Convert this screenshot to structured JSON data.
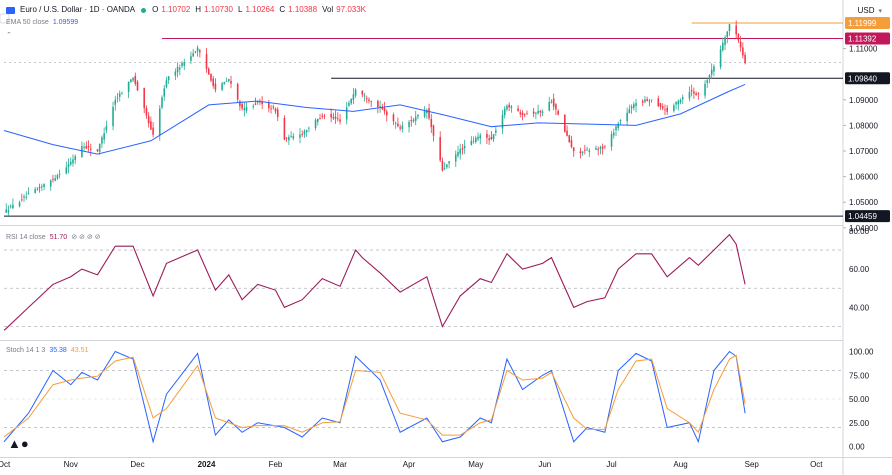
{
  "symbol": {
    "title": "Euro / U.S. Dollar · 1D · OANDA",
    "o_label": "O",
    "o": "1.10702",
    "h_label": "H",
    "h": "1.10730",
    "l_label": "L",
    "l": "1.10264",
    "c_label": "C",
    "c": "1.10388",
    "vol_label": "Vol",
    "vol": "97.033K",
    "currency": "USD"
  },
  "ema_legend": {
    "label": "EMA 50 close",
    "value": "1.09599"
  },
  "rsi_legend": {
    "label": "RSI 14 close",
    "value": "51.70"
  },
  "stoch_legend": {
    "label": "Stoch 14 1 3",
    "k": "35.38",
    "d": "43.51"
  },
  "colors": {
    "up": "#22ab94",
    "down": "#f23645",
    "ema": "#2962ff",
    "rsi": "#9c1b5b",
    "stoch_k": "#2962ff",
    "stoch_d": "#f59d3a",
    "high_line": "#f59d3a",
    "mid_line": "#c2185b",
    "support": "#131722"
  },
  "chart_data": [
    {
      "type": "candlestick",
      "price_labels": [
        {
          "value": 1.11999,
          "text": "1.11999",
          "color": "#f59d3a"
        },
        {
          "value": 1.11392,
          "text": "1.11392",
          "color": "#c2185b"
        },
        {
          "value": 1.0984,
          "text": "1.09840",
          "color": "#131722"
        },
        {
          "value": 1.04459,
          "text": "1.04459",
          "color": "#131722"
        }
      ],
      "horizontal_lines": [
        {
          "value": 1.11999,
          "from": "2024-08-06",
          "color": "#f59d3a"
        },
        {
          "value": 1.11392,
          "from": "2023-12-12",
          "color": "#c2185b"
        },
        {
          "value": 1.0984,
          "from": "2024-02-26",
          "color": "#131722"
        },
        {
          "value": 1.04459,
          "from": "2023-10-02",
          "color": "#131722"
        }
      ],
      "y_ticks": [
        1.11,
        1.09,
        1.08,
        1.07,
        1.06,
        1.05,
        1.04
      ],
      "y_tick_labels": [
        "1.11000",
        "1.09000",
        "1.08000",
        "1.07000",
        "1.06000",
        "1.05000",
        "1.04000"
      ],
      "ylim": [
        1.0415,
        1.1235
      ],
      "x_tick_labels": [
        "Oct",
        "Nov",
        "Dec",
        "2024",
        "Feb",
        "Mar",
        "Apr",
        "May",
        "Jun",
        "Jul",
        "Aug",
        "Sep",
        "Oct"
      ],
      "x_tick_dates": [
        "2023-10-02",
        "2023-11-01",
        "2023-12-01",
        "2024-01-01",
        "2024-02-01",
        "2024-03-01",
        "2024-04-01",
        "2024-05-01",
        "2024-06-01",
        "2024-07-01",
        "2024-08-01",
        "2024-09-02",
        "2024-10-01"
      ],
      "xlim": [
        "2023-10-02",
        "2024-10-13"
      ],
      "close_path_dates": [
        "2023-10-02",
        "2023-10-03",
        "2023-10-13",
        "2023-10-24",
        "2023-11-01",
        "2023-11-06",
        "2023-11-13",
        "2023-11-21",
        "2023-11-29",
        "2023-12-08",
        "2023-12-14",
        "2023-12-28",
        "2024-01-05",
        "2024-01-11",
        "2024-01-17",
        "2024-01-24",
        "2024-02-01",
        "2024-02-05",
        "2024-02-13",
        "2024-02-22",
        "2024-03-01",
        "2024-03-08",
        "2024-03-11",
        "2024-03-19",
        "2024-03-28",
        "2024-04-09",
        "2024-04-16",
        "2024-04-24",
        "2024-05-03",
        "2024-05-08",
        "2024-05-15",
        "2024-05-22",
        "2024-05-31",
        "2024-06-04",
        "2024-06-14",
        "2024-06-20",
        "2024-06-28",
        "2024-07-04",
        "2024-07-12",
        "2024-07-19",
        "2024-07-26",
        "2024-08-05",
        "2024-08-09",
        "2024-08-16",
        "2024-08-23",
        "2024-08-26",
        "2024-08-30"
      ],
      "close_path_values": [
        1.0465,
        1.0468,
        1.053,
        1.059,
        1.0655,
        1.072,
        1.07,
        1.09,
        1.099,
        1.076,
        1.098,
        1.11,
        1.094,
        1.098,
        1.086,
        1.089,
        1.086,
        1.0745,
        1.077,
        1.084,
        1.082,
        1.094,
        1.092,
        1.087,
        1.079,
        1.086,
        1.0625,
        1.0705,
        1.076,
        1.0745,
        1.088,
        1.0845,
        1.0855,
        1.09,
        1.0695,
        1.07,
        1.0715,
        1.081,
        1.089,
        1.09,
        1.0855,
        1.0935,
        1.092,
        1.103,
        1.119,
        1.116,
        1.1046
      ],
      "ema_dates": [
        "2023-10-02",
        "2023-10-24",
        "2023-11-13",
        "2023-12-07",
        "2024-01-02",
        "2024-01-24",
        "2024-02-15",
        "2024-03-07",
        "2024-03-28",
        "2024-04-17",
        "2024-05-08",
        "2024-05-29",
        "2024-06-21",
        "2024-07-12",
        "2024-08-01",
        "2024-08-22",
        "2024-08-30"
      ],
      "ema_values": [
        1.078,
        1.0725,
        1.0688,
        1.074,
        1.088,
        1.0895,
        1.087,
        1.0855,
        1.088,
        1.084,
        1.0795,
        1.081,
        1.0805,
        1.08,
        1.0845,
        1.093,
        1.096
      ]
    },
    {
      "type": "line",
      "title": "RSI",
      "ylim": [
        24,
        82
      ],
      "y_ticks": [
        40,
        60,
        80
      ],
      "y_tick_labels": [
        "40.00",
        "60.00",
        "80.00"
      ],
      "bands": [
        30,
        50,
        70
      ],
      "x": [
        "2023-10-02",
        "2023-10-03",
        "2023-10-13",
        "2023-10-24",
        "2023-11-01",
        "2023-11-06",
        "2023-11-13",
        "2023-11-21",
        "2023-11-29",
        "2023-12-08",
        "2023-12-14",
        "2023-12-28",
        "2024-01-05",
        "2024-01-11",
        "2024-01-17",
        "2024-01-24",
        "2024-02-01",
        "2024-02-05",
        "2024-02-13",
        "2024-02-22",
        "2024-03-01",
        "2024-03-08",
        "2024-03-11",
        "2024-03-19",
        "2024-03-28",
        "2024-04-09",
        "2024-04-16",
        "2024-04-24",
        "2024-05-03",
        "2024-05-08",
        "2024-05-15",
        "2024-05-22",
        "2024-05-31",
        "2024-06-04",
        "2024-06-14",
        "2024-06-20",
        "2024-06-28",
        "2024-07-04",
        "2024-07-12",
        "2024-07-19",
        "2024-07-26",
        "2024-08-05",
        "2024-08-09",
        "2024-08-16",
        "2024-08-23",
        "2024-08-26",
        "2024-08-30"
      ],
      "values": [
        28,
        29,
        40,
        52,
        56,
        60,
        57,
        72,
        72,
        46,
        63,
        70,
        49,
        57,
        44,
        52,
        49,
        40,
        44,
        55,
        51,
        70,
        66,
        58,
        48,
        56,
        30,
        46,
        55,
        53,
        68,
        60,
        63,
        66,
        40,
        43,
        45,
        60,
        68,
        68,
        56,
        66,
        62,
        70,
        78,
        73,
        52
      ]
    },
    {
      "type": "line",
      "title": "Stoch",
      "ylim": [
        -10,
        110
      ],
      "y_ticks": [
        0,
        25,
        50,
        75,
        100
      ],
      "y_tick_labels": [
        "0.00",
        "25.00",
        "50.00",
        "75.00",
        "100.00"
      ],
      "bands": [
        20,
        80
      ],
      "x": [
        "2023-10-02",
        "2023-10-13",
        "2023-10-24",
        "2023-11-01",
        "2023-11-06",
        "2023-11-13",
        "2023-11-21",
        "2023-11-29",
        "2023-12-08",
        "2023-12-14",
        "2023-12-28",
        "2024-01-05",
        "2024-01-11",
        "2024-01-17",
        "2024-01-24",
        "2024-02-05",
        "2024-02-13",
        "2024-02-22",
        "2024-03-01",
        "2024-03-08",
        "2024-03-19",
        "2024-03-28",
        "2024-04-09",
        "2024-04-16",
        "2024-04-24",
        "2024-05-03",
        "2024-05-08",
        "2024-05-15",
        "2024-05-22",
        "2024-05-31",
        "2024-06-04",
        "2024-06-14",
        "2024-06-20",
        "2024-06-28",
        "2024-07-04",
        "2024-07-12",
        "2024-07-19",
        "2024-07-26",
        "2024-08-05",
        "2024-08-09",
        "2024-08-16",
        "2024-08-23",
        "2024-08-26",
        "2024-08-30"
      ],
      "series": [
        {
          "legend": "35.38",
          "values": [
            5,
            35,
            80,
            65,
            78,
            70,
            100,
            92,
            5,
            55,
            98,
            12,
            28,
            15,
            25,
            20,
            10,
            30,
            25,
            95,
            70,
            15,
            30,
            5,
            10,
            30,
            25,
            92,
            60,
            75,
            80,
            5,
            20,
            15,
            80,
            98,
            90,
            20,
            25,
            5,
            80,
            100,
            95,
            35
          ]
        },
        {
          "legend": "43.51",
          "values": [
            10,
            30,
            65,
            70,
            72,
            74,
            90,
            94,
            30,
            40,
            85,
            30,
            25,
            20,
            22,
            22,
            15,
            25,
            26,
            80,
            78,
            35,
            28,
            12,
            12,
            25,
            28,
            80,
            70,
            72,
            78,
            30,
            18,
            18,
            60,
            90,
            92,
            40,
            25,
            15,
            60,
            92,
            96,
            45
          ]
        }
      ]
    }
  ]
}
